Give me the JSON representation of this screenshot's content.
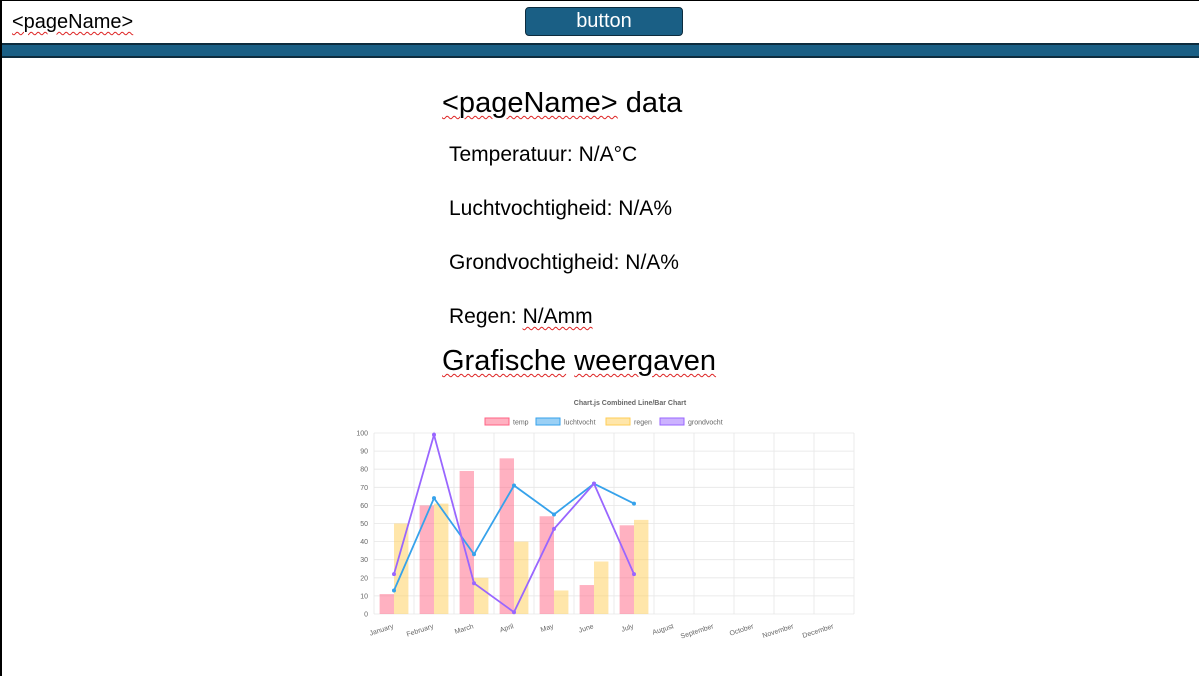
{
  "header": {
    "page_name": "<pageName>",
    "button_label": "button"
  },
  "data_section": {
    "title_prefix": "<pageName>",
    "title_suffix": " data",
    "readings": [
      {
        "label": "Temperatuur: ",
        "value": "N/A",
        "unit": "°C"
      },
      {
        "label": "Luchtvochtigheid: ",
        "value": "N/A",
        "unit": "%"
      },
      {
        "label": "Grondvochtigheid: ",
        "value": "N/A",
        "unit": "%"
      },
      {
        "label": "Regen: ",
        "value": "N/A",
        "unit": "mm"
      }
    ]
  },
  "charts_title_words": [
    "Grafische",
    "weergaven"
  ],
  "colors": {
    "accent": "#1a5f85",
    "temp": "#ff6384",
    "luchtvocht": "#36a2eb",
    "regen": "#ffcd56",
    "grondvocht": "#9966ff"
  },
  "chart_data": {
    "type": "bar",
    "title": "Chart.js Combined Line/Bar Chart",
    "categories": [
      "January",
      "February",
      "March",
      "April",
      "May",
      "June",
      "July",
      "August",
      "September",
      "October",
      "November",
      "December"
    ],
    "ylim": [
      0,
      100
    ],
    "yticks": [
      0,
      10,
      20,
      30,
      40,
      50,
      60,
      70,
      80,
      90,
      100
    ],
    "grid": true,
    "legend_position": "top",
    "series": [
      {
        "name": "temp",
        "kind": "bar",
        "values": [
          11,
          60,
          79,
          86,
          54,
          16,
          49,
          null,
          null,
          null,
          null,
          null
        ]
      },
      {
        "name": "luchtvocht",
        "kind": "line",
        "values": [
          13,
          64,
          33,
          71,
          55,
          72,
          61,
          null,
          null,
          null,
          null,
          null
        ]
      },
      {
        "name": "regen",
        "kind": "bar",
        "values": [
          50,
          61,
          20,
          40,
          13,
          29,
          52,
          null,
          null,
          null,
          null,
          null
        ]
      },
      {
        "name": "grondvocht",
        "kind": "line",
        "values": [
          22,
          99,
          17,
          1,
          47,
          72,
          22,
          null,
          null,
          null,
          null,
          null
        ]
      }
    ]
  }
}
